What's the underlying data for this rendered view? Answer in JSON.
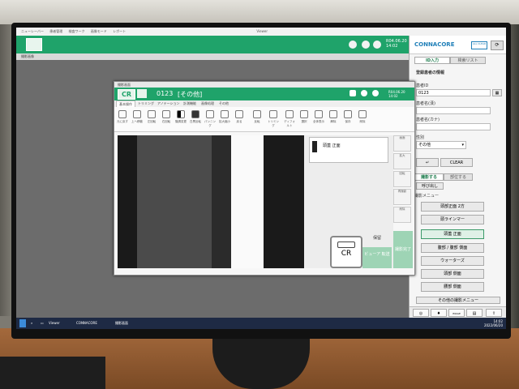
{
  "main": {
    "topstrip": [
      "ニューレーバー",
      "患者管理",
      "検査ワーク",
      "画像モード",
      "レポート"
    ],
    "sublabel": "撮影画像",
    "date": "R04.06.20",
    "time": "14:02",
    "titlebar": "Viewer"
  },
  "right_panel": {
    "brand": "CONNACORE",
    "badge": "ALL CLEAR",
    "refresh_icon": "refresh-icon",
    "tabs": [
      "ID入力",
      "検索リスト"
    ],
    "heading": "登録患者の情報",
    "id_label": "患者ID",
    "id_value": "0123",
    "name_label": "患者名(漢)",
    "kana_label": "患者名(カナ)",
    "sex_label": "性別",
    "sex_value": "その他",
    "clear_label": "CLEAR",
    "enter_icon": "enter-icon",
    "exam_tabs": [
      "撮影する",
      "部位する"
    ],
    "recall_label": "呼び出し",
    "menu_title": "撮影メニュー",
    "menu_items": [
      "頭部正面 2方",
      "頭ラインマー",
      "頭蓋 正面",
      "腹部 / 腹部 側面",
      "ウォーターズ",
      "頭部 側面",
      "腰部 側面"
    ],
    "other_menu": "その他の撮影メニュー",
    "footer": [
      "◎",
      "♦",
      "IMAGE",
      "▤",
      "⇧"
    ]
  },
  "dialog": {
    "title": "撮影画面",
    "cr": "CR",
    "patient_id": "0123",
    "patient_name": "[その他]",
    "date": "R04.06.20",
    "time": "14:02",
    "tabs": [
      "基本操作",
      "トリミング",
      "アノテーション",
      "計測機能",
      "画像処理",
      "その他"
    ],
    "tools": [
      "元に戻す",
      "上へ移動",
      "左回転",
      "右回転",
      "階調変更",
      "白黒反転",
      "パンニング",
      "拡大縮小",
      "戻る",
      "反転",
      "トリミング",
      "ディフォルト",
      "選択",
      "全体表示",
      "解除",
      "保存",
      "削除"
    ],
    "thumb_label": "頭蓋 正面",
    "side_buttons": [
      "画面",
      "拡大",
      "回転",
      "再撮影",
      "削除"
    ],
    "hold": "保留",
    "viewer_btn": "ビューア\n転送",
    "finish": "撮影完了",
    "cr_big": "CR"
  },
  "taskbar": {
    "items": [
      "Viewer",
      "CONNACORE",
      "撮影画面"
    ],
    "clock": "14:02",
    "date": "2022/06/20"
  }
}
